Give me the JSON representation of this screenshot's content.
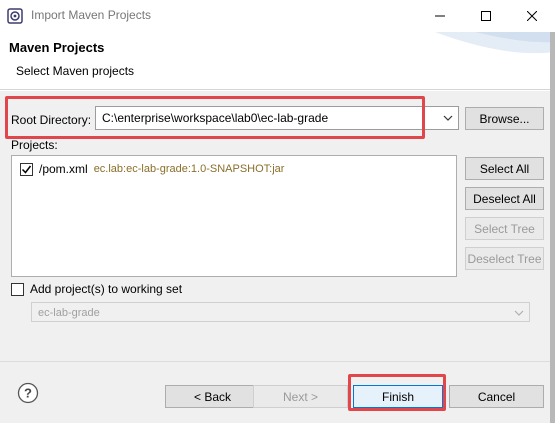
{
  "window": {
    "title": "Import Maven Projects"
  },
  "header": {
    "title": "Maven Projects",
    "subtitle": "Select Maven projects"
  },
  "root_directory": {
    "label": "Root Directory:",
    "value": "C:\\enterprise\\workspace\\lab0\\ec-lab-grade",
    "browse_label": "Browse..."
  },
  "projects": {
    "label": "Projects:",
    "items": [
      {
        "name": "/pom.xml",
        "coordinates": "ec.lab:ec-lab-grade:1.0-SNAPSHOT:jar",
        "checked": true
      }
    ],
    "select_all_label": "Select All",
    "deselect_all_label": "Deselect All",
    "select_tree_label": "Select Tree",
    "deselect_tree_label": "Deselect Tree"
  },
  "working_set": {
    "label": "Add project(s) to working set",
    "checked": false,
    "value": "ec-lab-grade"
  },
  "footer": {
    "back_label": "< Back",
    "next_label": "Next >",
    "finish_label": "Finish",
    "cancel_label": "Cancel"
  },
  "icons": {
    "app": "eclipse-icon",
    "help": "help-icon",
    "minimize": "minimize-icon",
    "maximize": "maximize-icon",
    "close": "close-icon"
  },
  "colors": {
    "highlight": "#e0464a",
    "coordinates_text": "#8a6f2a",
    "focus_border": "#0078d7"
  }
}
